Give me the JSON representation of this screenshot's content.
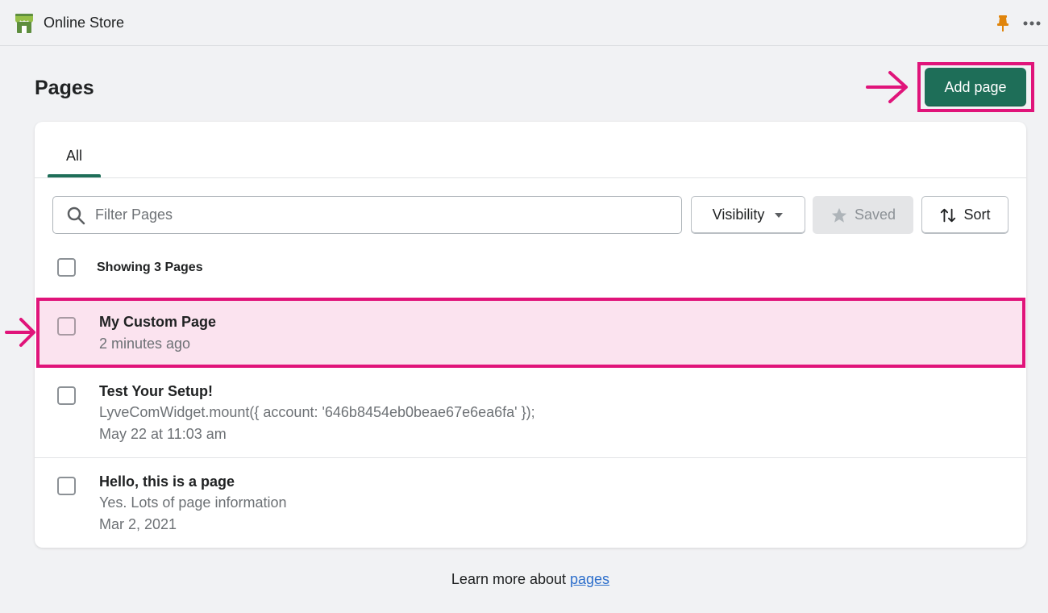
{
  "app": {
    "title": "Online Store"
  },
  "page": {
    "title": "Pages",
    "add_button": "Add page"
  },
  "tabs": [
    {
      "label": "All"
    }
  ],
  "filter": {
    "placeholder": "Filter Pages",
    "visibility_label": "Visibility",
    "saved_label": "Saved",
    "sort_label": "Sort"
  },
  "list": {
    "showing_label": "Showing 3 Pages",
    "items": [
      {
        "title": "My Custom Page",
        "line1": "2 minutes ago"
      },
      {
        "title": "Test Your Setup!",
        "line1": "LyveComWidget.mount({ account: '646b8454eb0beae67e6ea6fa' });",
        "line2": "May 22 at 11:03 am"
      },
      {
        "title": "Hello, this is a page",
        "line1": "Yes. Lots of page information",
        "line2": "Mar 2, 2021"
      }
    ]
  },
  "footer": {
    "prefix": "Learn more about ",
    "link": "pages"
  },
  "colors": {
    "accent": "#1e6e58",
    "highlight": "#e0147a",
    "highlight_bg": "#fbe3ef",
    "link": "#2c6ecb"
  },
  "icons": [
    "store-icon",
    "pin-icon",
    "more-icon",
    "search-icon",
    "caret-down-icon",
    "star-icon",
    "sort-icon",
    "arrow-right-icon"
  ]
}
